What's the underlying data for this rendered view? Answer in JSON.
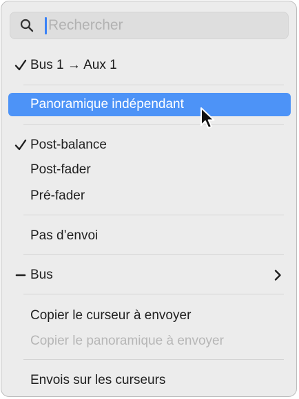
{
  "search": {
    "placeholder": "Rechercher",
    "value": ""
  },
  "menu": {
    "send_item": {
      "label": "Bus 1 → Aux 1",
      "checked": true
    },
    "independent_pan": {
      "label": "Panoramique indépendant",
      "highlighted": true
    },
    "post_balance": {
      "label": "Post-balance",
      "checked": true
    },
    "post_fader": {
      "label": "Post-fader"
    },
    "pre_fader": {
      "label": "Pré-fader"
    },
    "no_send": {
      "label": "Pas d’envoi"
    },
    "bus": {
      "label": "Bus",
      "mixed_state": true,
      "has_submenu": true
    },
    "copy_send_fader": {
      "label": "Copier le curseur à envoyer"
    },
    "copy_pan": {
      "label": "Copier le panoramique à envoyer",
      "disabled": true
    },
    "sends_on_faders": {
      "label": "Envois sur les curseurs"
    }
  },
  "colors": {
    "highlight": "#4d93f7",
    "caret": "#3a82f7",
    "menu_background": "#ececec",
    "disabled_text": "#b6b6b6"
  },
  "icons": {
    "search": "search-icon",
    "check": "checkmark-icon",
    "mixed": "dash-icon",
    "submenu": "chevron-right-icon",
    "pointer": "mouse-pointer-icon"
  }
}
